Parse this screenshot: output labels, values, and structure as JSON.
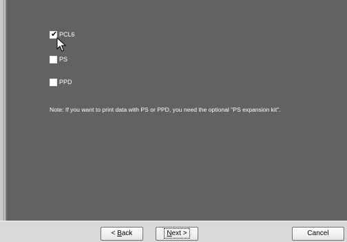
{
  "options": [
    {
      "label": "PCL6",
      "checked": true
    },
    {
      "label": "PS",
      "checked": false
    },
    {
      "label": "PPD",
      "checked": false
    }
  ],
  "note": "Note: If you want to print data with PS or PPD, you need the optional \"PS expansion kit\".",
  "buttons": {
    "back": {
      "prefix": "< ",
      "accel": "B",
      "rest": "ack"
    },
    "next": {
      "accel": "N",
      "rest": "ext >"
    },
    "cancel": "Cancel"
  },
  "colors": {
    "panel": "#626262",
    "bar": "#d9d9d9"
  }
}
